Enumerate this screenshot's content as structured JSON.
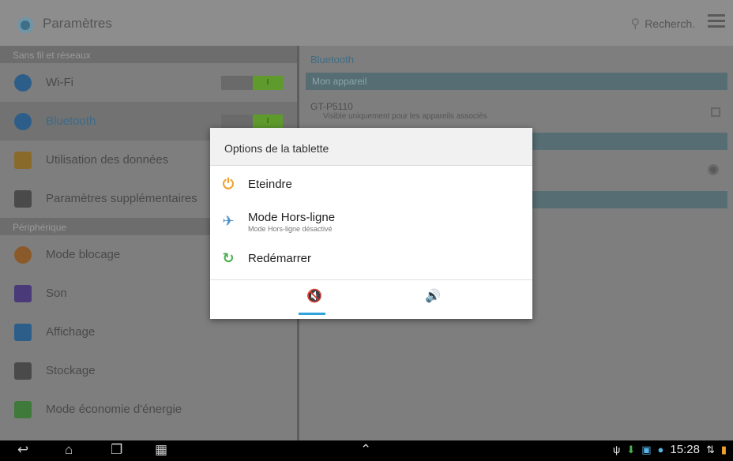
{
  "action_bar": {
    "title": "Paramètres",
    "search_label": "Recherch."
  },
  "left_panel": {
    "sections": [
      {
        "header": "Sans fil et réseaux",
        "items": [
          {
            "label": "Wi-Fi",
            "icon": "wifi-icon",
            "switch": "I"
          },
          {
            "label": "Bluetooth",
            "icon": "bluetooth-icon",
            "switch": "I"
          },
          {
            "label": "Utilisation des données",
            "icon": "data-usage-icon"
          },
          {
            "label": "Paramètres supplémentaires",
            "icon": "more-settings-icon"
          }
        ]
      },
      {
        "header": "Périphérique",
        "items": [
          {
            "label": "Mode blocage",
            "icon": "blocking-mode-icon"
          },
          {
            "label": "Son",
            "icon": "sound-icon"
          },
          {
            "label": "Affichage",
            "icon": "display-icon"
          },
          {
            "label": "Stockage",
            "icon": "storage-icon"
          },
          {
            "label": "Mode économie d'énergie",
            "icon": "power-saving-icon"
          }
        ]
      }
    ]
  },
  "right_panel": {
    "title": "Bluetooth",
    "bar1": "Mon appareil",
    "device_name": "GT-P5110",
    "device_sub": "Visible uniquement pour les appareils associés"
  },
  "dialog": {
    "title": "Options de la tablette",
    "items": [
      {
        "label": "Eteindre",
        "icon": "power-icon"
      },
      {
        "label": "Mode Hors-ligne",
        "sub": "Mode Hors-ligne désactivé",
        "icon": "airplane-icon"
      },
      {
        "label": "Redémarrer",
        "icon": "restart-icon"
      }
    ],
    "modes": [
      {
        "name": "silent",
        "icon": "mute-icon",
        "selected": true
      },
      {
        "name": "sound",
        "icon": "sound-on-icon",
        "selected": false
      }
    ]
  },
  "status_bar": {
    "time": "15:28"
  },
  "colors": {
    "accent": "#31a3dc",
    "toggle_on": "#5e9a2c",
    "power": "#f0a030",
    "restart": "#4caf50"
  }
}
